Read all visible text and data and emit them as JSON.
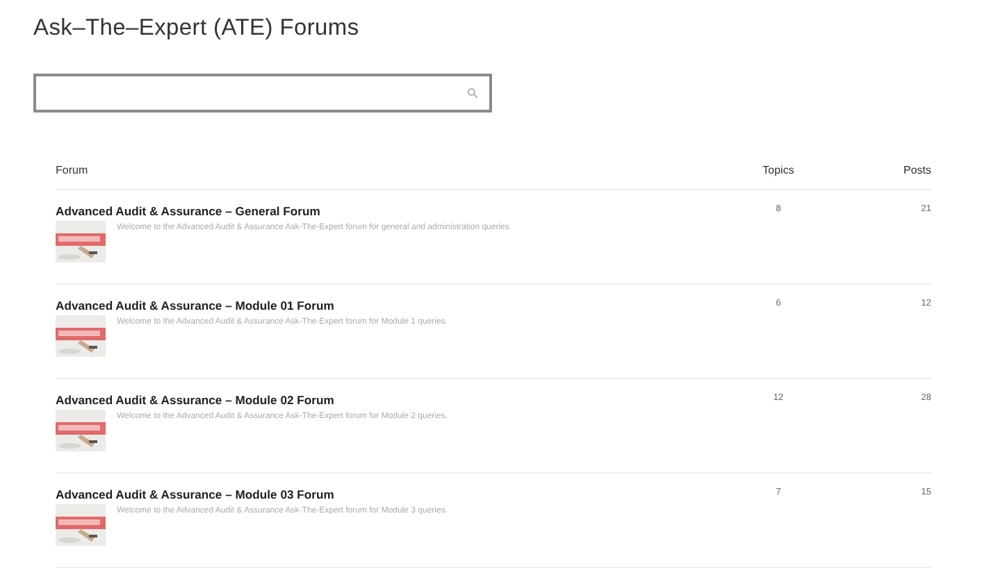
{
  "page": {
    "title": "Ask–The–Expert (ATE) Forums"
  },
  "table": {
    "columns": [
      "Forum",
      "Topics",
      "Posts"
    ],
    "rows": [
      {
        "title": "Advanced Audit & Assurance – General Forum",
        "description": "Welcome to the Advanced Audit & Assurance Ask-The-Expert forum for general and administration queries.",
        "topics": "8",
        "posts": "21"
      },
      {
        "title": "Advanced Audit & Assurance – Module 01 Forum",
        "description": "Welcome to the Advanced Audit & Assurance Ask-The-Expert forum for Module 1 queries.",
        "topics": "6",
        "posts": "12"
      },
      {
        "title": "Advanced Audit & Assurance – Module 02 Forum",
        "description": "Welcome to the Advanced Audit & Assurance Ask-The-Expert forum for Module 2 queries.",
        "topics": "12",
        "posts": "28"
      },
      {
        "title": "Advanced Audit & Assurance – Module 03 Forum",
        "description": "Welcome to the Advanced Audit & Assurance Ask-The-Expert forum for Module 3 queries.",
        "topics": "7",
        "posts": "15"
      }
    ]
  }
}
